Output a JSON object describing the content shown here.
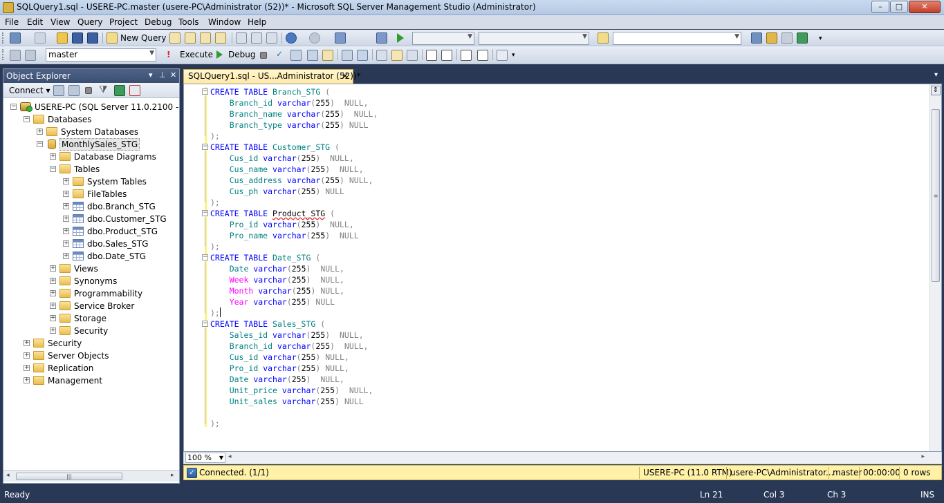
{
  "window": {
    "title": "SQLQuery1.sql - USERE-PC.master (usere-PC\\Administrator (52))* - Microsoft SQL Server Management Studio (Administrator)",
    "min_glyph": "–",
    "max_glyph": "□",
    "close_glyph": "✕"
  },
  "menu": [
    "File",
    "Edit",
    "View",
    "Query",
    "Project",
    "Debug",
    "Tools",
    "Window",
    "Help"
  ],
  "toolbar1": {
    "new_query_label": "New Query"
  },
  "toolbar2": {
    "database": "master",
    "execute_label": "Execute",
    "debug_label": "Debug"
  },
  "object_explorer": {
    "title": "Object Explorer",
    "connect_label": "Connect",
    "tree": [
      {
        "label": "USERE-PC (SQL Server 11.0.2100 - usere",
        "icon": "server-icon",
        "expanded": true,
        "depth": 0
      },
      {
        "label": "Databases",
        "icon": "folder-icon",
        "expanded": true,
        "depth": 1
      },
      {
        "label": "System Databases",
        "icon": "folder-icon",
        "expanded": false,
        "depth": 2
      },
      {
        "label": "MonthlySales_STG",
        "icon": "database-icon",
        "expanded": true,
        "depth": 2,
        "selected": true
      },
      {
        "label": "Database Diagrams",
        "icon": "folder-icon",
        "expanded": false,
        "depth": 3
      },
      {
        "label": "Tables",
        "icon": "folder-icon",
        "expanded": true,
        "depth": 3
      },
      {
        "label": "System Tables",
        "icon": "folder-icon",
        "expanded": false,
        "depth": 4
      },
      {
        "label": "FileTables",
        "icon": "folder-icon",
        "expanded": false,
        "depth": 4
      },
      {
        "label": "dbo.Branch_STG",
        "icon": "table-icon",
        "expanded": false,
        "depth": 4
      },
      {
        "label": "dbo.Customer_STG",
        "icon": "table-icon",
        "expanded": false,
        "depth": 4
      },
      {
        "label": "dbo.Product_STG",
        "icon": "table-icon",
        "expanded": false,
        "depth": 4
      },
      {
        "label": "dbo.Sales_STG",
        "icon": "table-icon",
        "expanded": false,
        "depth": 4
      },
      {
        "label": "dbo.Date_STG",
        "icon": "table-icon",
        "expanded": false,
        "depth": 4
      },
      {
        "label": "Views",
        "icon": "folder-icon",
        "expanded": false,
        "depth": 3
      },
      {
        "label": "Synonyms",
        "icon": "folder-icon",
        "expanded": false,
        "depth": 3
      },
      {
        "label": "Programmability",
        "icon": "folder-icon",
        "expanded": false,
        "depth": 3
      },
      {
        "label": "Service Broker",
        "icon": "folder-icon",
        "expanded": false,
        "depth": 3
      },
      {
        "label": "Storage",
        "icon": "folder-icon",
        "expanded": false,
        "depth": 3
      },
      {
        "label": "Security",
        "icon": "folder-icon",
        "expanded": false,
        "depth": 3
      },
      {
        "label": "Security",
        "icon": "folder-icon",
        "expanded": false,
        "depth": 1
      },
      {
        "label": "Server Objects",
        "icon": "folder-icon",
        "expanded": false,
        "depth": 1
      },
      {
        "label": "Replication",
        "icon": "folder-icon",
        "expanded": false,
        "depth": 1
      },
      {
        "label": "Management",
        "icon": "folder-icon",
        "expanded": false,
        "depth": 1
      }
    ]
  },
  "editor": {
    "tab_label": "SQLQuery1.sql - US...Administrator (52))*",
    "tab_close": "✕",
    "zoom": "100 %",
    "lines": [
      [
        [
          "kw",
          "CREATE TABLE "
        ],
        [
          "id",
          "Branch_STG"
        ],
        [
          "pn",
          " ("
        ]
      ],
      [
        [
          "t",
          "    "
        ],
        [
          "id",
          "Branch_id"
        ],
        [
          "t",
          " "
        ],
        [
          "kw",
          "varchar"
        ],
        [
          "pn",
          "("
        ],
        [
          "t",
          "255"
        ],
        [
          "pn",
          ")"
        ],
        [
          "nul",
          "  NULL"
        ],
        [
          "pn",
          ","
        ]
      ],
      [
        [
          "t",
          "    "
        ],
        [
          "id",
          "Branch_name"
        ],
        [
          "t",
          " "
        ],
        [
          "kw",
          "varchar"
        ],
        [
          "pn",
          "("
        ],
        [
          "t",
          "255"
        ],
        [
          "pn",
          ")"
        ],
        [
          "nul",
          "  NULL"
        ],
        [
          "pn",
          ","
        ]
      ],
      [
        [
          "t",
          "    "
        ],
        [
          "id",
          "Branch_type"
        ],
        [
          "t",
          " "
        ],
        [
          "kw",
          "varchar"
        ],
        [
          "pn",
          "("
        ],
        [
          "t",
          "255"
        ],
        [
          "pn",
          ")"
        ],
        [
          "nul",
          " NULL"
        ]
      ],
      [
        [
          "pn",
          ");"
        ]
      ],
      [
        [
          "kw",
          "CREATE TABLE "
        ],
        [
          "id",
          "Customer_STG"
        ],
        [
          "pn",
          " ("
        ]
      ],
      [
        [
          "t",
          "    "
        ],
        [
          "id",
          "Cus_id"
        ],
        [
          "t",
          " "
        ],
        [
          "kw",
          "varchar"
        ],
        [
          "pn",
          "("
        ],
        [
          "t",
          "255"
        ],
        [
          "pn",
          ")"
        ],
        [
          "nul",
          "  NULL"
        ],
        [
          "pn",
          ","
        ]
      ],
      [
        [
          "t",
          "    "
        ],
        [
          "id",
          "Cus_name"
        ],
        [
          "t",
          " "
        ],
        [
          "kw",
          "varchar"
        ],
        [
          "pn",
          "("
        ],
        [
          "t",
          "255"
        ],
        [
          "pn",
          ")"
        ],
        [
          "nul",
          "  NULL"
        ],
        [
          "pn",
          ","
        ]
      ],
      [
        [
          "t",
          "    "
        ],
        [
          "id",
          "Cus_address"
        ],
        [
          "t",
          " "
        ],
        [
          "kw",
          "varchar"
        ],
        [
          "pn",
          "("
        ],
        [
          "t",
          "255"
        ],
        [
          "pn",
          ")"
        ],
        [
          "nul",
          " NULL"
        ],
        [
          "pn",
          ","
        ]
      ],
      [
        [
          "t",
          "    "
        ],
        [
          "id",
          "Cus_ph"
        ],
        [
          "t",
          " "
        ],
        [
          "kw",
          "varchar"
        ],
        [
          "pn",
          "("
        ],
        [
          "t",
          "255"
        ],
        [
          "pn",
          ")"
        ],
        [
          "nul",
          " NULL"
        ]
      ],
      [
        [
          "pn",
          ");"
        ]
      ],
      [
        [
          "kw",
          "CREATE TABLE "
        ],
        [
          "sq",
          "Product_STG"
        ],
        [
          "pn",
          " ("
        ]
      ],
      [
        [
          "t",
          "    "
        ],
        [
          "id",
          "Pro_id"
        ],
        [
          "t",
          " "
        ],
        [
          "kw",
          "varchar"
        ],
        [
          "pn",
          "("
        ],
        [
          "t",
          "255"
        ],
        [
          "pn",
          ")"
        ],
        [
          "nul",
          "  NULL"
        ],
        [
          "pn",
          ","
        ]
      ],
      [
        [
          "t",
          "    "
        ],
        [
          "id",
          "Pro_name"
        ],
        [
          "t",
          " "
        ],
        [
          "kw",
          "varchar"
        ],
        [
          "pn",
          "("
        ],
        [
          "t",
          "255"
        ],
        [
          "pn",
          ")"
        ],
        [
          "nul",
          "  NULL"
        ]
      ],
      [
        [
          "pn",
          ");"
        ]
      ],
      [
        [
          "kw",
          "CREATE TABLE "
        ],
        [
          "id",
          "Date_STG"
        ],
        [
          "pn",
          " ("
        ]
      ],
      [
        [
          "t",
          "    "
        ],
        [
          "id",
          "Date"
        ],
        [
          "t",
          " "
        ],
        [
          "kw",
          "varchar"
        ],
        [
          "pn",
          "("
        ],
        [
          "t",
          "255"
        ],
        [
          "pn",
          ")"
        ],
        [
          "nul",
          "  NULL"
        ],
        [
          "pn",
          ","
        ]
      ],
      [
        [
          "t",
          "    "
        ],
        [
          "fn",
          "Week"
        ],
        [
          "t",
          " "
        ],
        [
          "kw",
          "varchar"
        ],
        [
          "pn",
          "("
        ],
        [
          "t",
          "255"
        ],
        [
          "pn",
          ")"
        ],
        [
          "nul",
          "  NULL"
        ],
        [
          "pn",
          ","
        ]
      ],
      [
        [
          "t",
          "    "
        ],
        [
          "fn",
          "Month"
        ],
        [
          "t",
          " "
        ],
        [
          "kw",
          "varchar"
        ],
        [
          "pn",
          "("
        ],
        [
          "t",
          "255"
        ],
        [
          "pn",
          ")"
        ],
        [
          "nul",
          " NULL"
        ],
        [
          "pn",
          ","
        ]
      ],
      [
        [
          "t",
          "    "
        ],
        [
          "fn",
          "Year"
        ],
        [
          "t",
          " "
        ],
        [
          "kw",
          "varchar"
        ],
        [
          "pn",
          "("
        ],
        [
          "t",
          "255"
        ],
        [
          "pn",
          ")"
        ],
        [
          "nul",
          " NULL"
        ]
      ],
      [
        [
          "pn",
          ");"
        ]
      ],
      [
        [
          "kw",
          "CREATE TABLE "
        ],
        [
          "id",
          "Sales_STG"
        ],
        [
          "pn",
          " ("
        ]
      ],
      [
        [
          "t",
          "    "
        ],
        [
          "id",
          "Sales_id"
        ],
        [
          "t",
          " "
        ],
        [
          "kw",
          "varchar"
        ],
        [
          "pn",
          "("
        ],
        [
          "t",
          "255"
        ],
        [
          "pn",
          ")"
        ],
        [
          "nul",
          "  NULL"
        ],
        [
          "pn",
          ","
        ]
      ],
      [
        [
          "t",
          "    "
        ],
        [
          "id",
          "Branch_id"
        ],
        [
          "t",
          " "
        ],
        [
          "kw",
          "varchar"
        ],
        [
          "pn",
          "("
        ],
        [
          "t",
          "255"
        ],
        [
          "pn",
          ")"
        ],
        [
          "nul",
          "  NULL"
        ],
        [
          "pn",
          ","
        ]
      ],
      [
        [
          "t",
          "    "
        ],
        [
          "id",
          "Cus_id"
        ],
        [
          "t",
          " "
        ],
        [
          "kw",
          "varchar"
        ],
        [
          "pn",
          "("
        ],
        [
          "t",
          "255"
        ],
        [
          "pn",
          ")"
        ],
        [
          "nul",
          " NULL"
        ],
        [
          "pn",
          ","
        ]
      ],
      [
        [
          "t",
          "    "
        ],
        [
          "id",
          "Pro_id"
        ],
        [
          "t",
          " "
        ],
        [
          "kw",
          "varchar"
        ],
        [
          "pn",
          "("
        ],
        [
          "t",
          "255"
        ],
        [
          "pn",
          ")"
        ],
        [
          "nul",
          " NULL"
        ],
        [
          "pn",
          ","
        ]
      ],
      [
        [
          "t",
          "    "
        ],
        [
          "id",
          "Date"
        ],
        [
          "t",
          " "
        ],
        [
          "kw",
          "varchar"
        ],
        [
          "pn",
          "("
        ],
        [
          "t",
          "255"
        ],
        [
          "pn",
          ")"
        ],
        [
          "nul",
          "  NULL"
        ],
        [
          "pn",
          ","
        ]
      ],
      [
        [
          "t",
          "    "
        ],
        [
          "id",
          "Unit_price"
        ],
        [
          "t",
          " "
        ],
        [
          "kw",
          "varchar"
        ],
        [
          "pn",
          "("
        ],
        [
          "t",
          "255"
        ],
        [
          "pn",
          ")"
        ],
        [
          "nul",
          "  NULL"
        ],
        [
          "pn",
          ","
        ]
      ],
      [
        [
          "t",
          "    "
        ],
        [
          "id",
          "Unit_sales"
        ],
        [
          "t",
          " "
        ],
        [
          "kw",
          "varchar"
        ],
        [
          "pn",
          "("
        ],
        [
          "t",
          "255"
        ],
        [
          "pn",
          ")"
        ],
        [
          "nul",
          " NULL"
        ]
      ],
      [
        [
          "t",
          ""
        ]
      ],
      [
        [
          "pn",
          ");"
        ]
      ]
    ]
  },
  "query_status": {
    "connected": "Connected. (1/1)",
    "server": "USERE-PC (11.0 RTM)",
    "user": "usere-PC\\Administrator...",
    "database": "master",
    "elapsed": "00:00:00",
    "rows": "0 rows"
  },
  "status_bar": {
    "ready": "Ready",
    "ln": "Ln 21",
    "col": "Col 3",
    "ch": "Ch 3",
    "ins": "INS"
  },
  "colors": {
    "keyword": "#0000ff",
    "identifier": "#008080",
    "null": "#808080",
    "function": "#ff00ff",
    "status_bar": "#293955",
    "query_status": "#fff2a8"
  }
}
